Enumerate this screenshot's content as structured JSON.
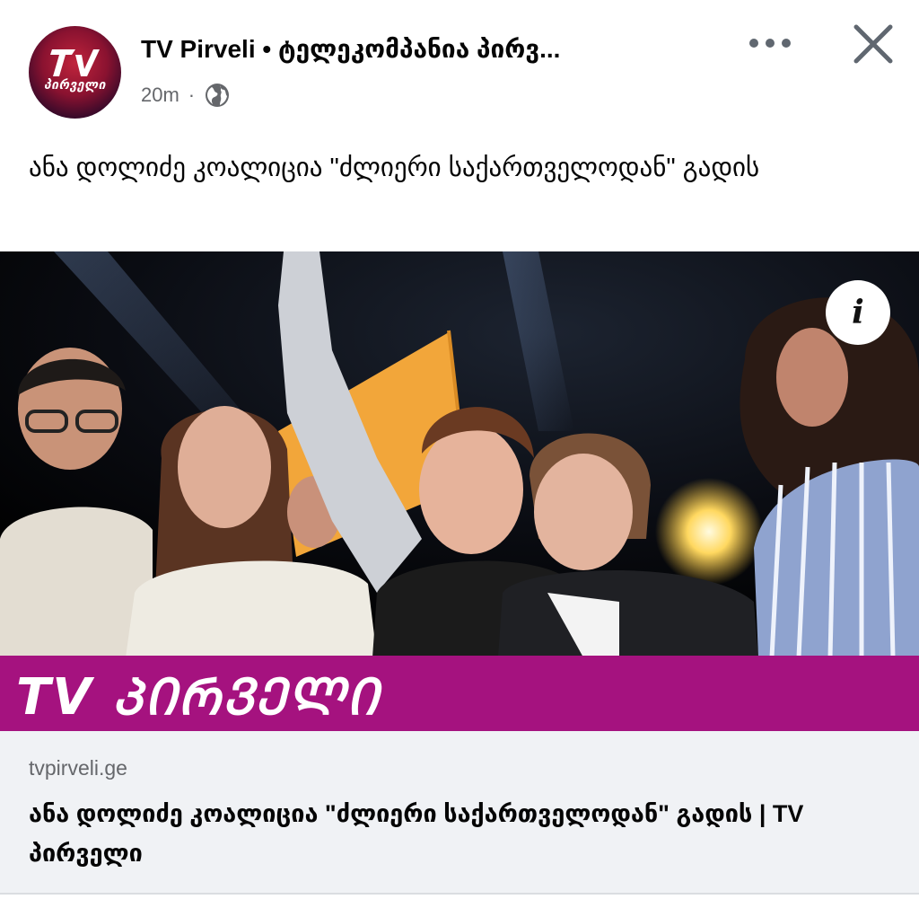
{
  "post": {
    "page_name": "TV Pirveli • ტელეკომპანია პირვ...",
    "avatar_text": "პირველი",
    "time": "20m",
    "separator": "·",
    "privacy_icon": "globe-icon",
    "menu_icon": "more-options-icon",
    "close_icon": "close-icon",
    "text": "ანა დოლიძე კოალიცია \"ძლიერი საქართველოდან\" გადის"
  },
  "media": {
    "info_label": "i",
    "banner_text": "TV ᲞᲘᲠᲕᲔᲚᲘ",
    "banner_color": "#a5127f"
  },
  "link": {
    "domain": "tvpirveli.ge",
    "title": "ანა დოლიძე კოალიცია \"ძლიერი საქართველოდან\" გადის | TV პირველი"
  },
  "colors": {
    "secondary_text": "#65676b",
    "card_bg": "#f0f2f5"
  }
}
